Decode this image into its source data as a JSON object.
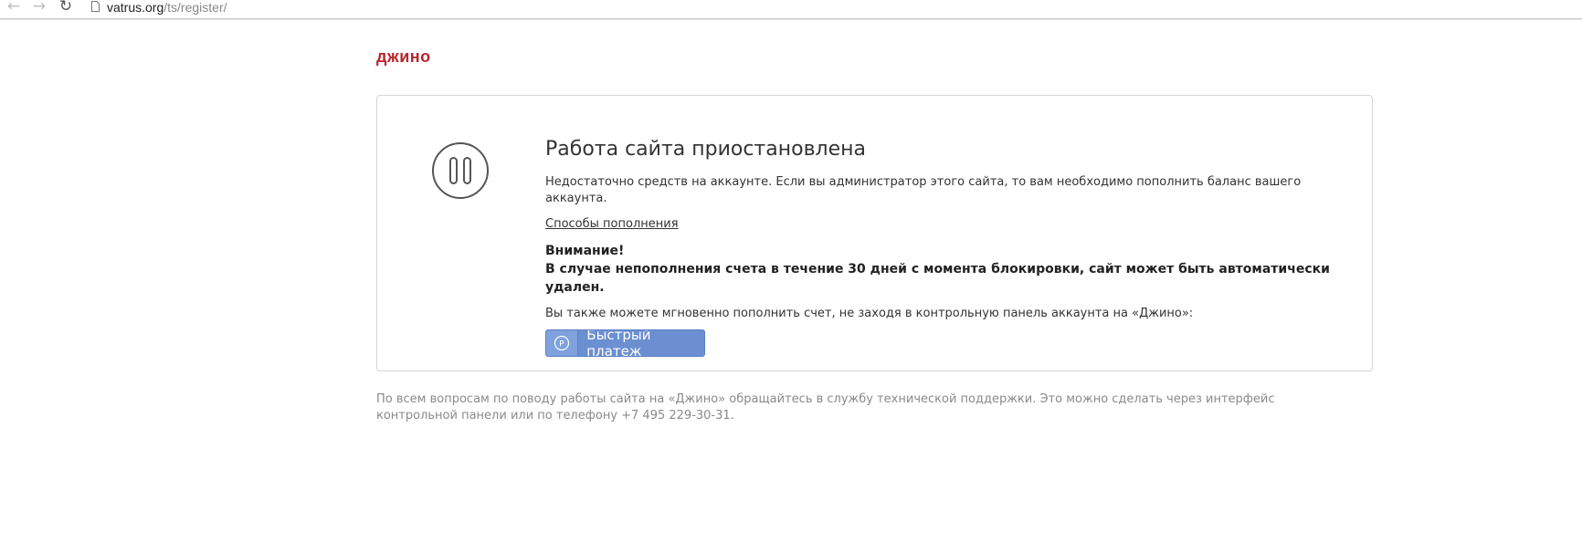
{
  "browser": {
    "url_host": "vatrus.org",
    "url_path": "/ts/register/",
    "back_icon": "arrow-left-icon",
    "forward_icon": "arrow-right-icon",
    "reload_icon": "reload-icon"
  },
  "logo": {
    "text": "джино",
    "color": "#b8252d"
  },
  "card": {
    "icon": "pause-circle-icon",
    "title": "Работа сайта приостановлена",
    "text": "Недостаточно средств на аккаунте. Если вы администратор этого сайта, то вам необходимо пополнить баланс вашего аккаунта.",
    "link": "Способы пополнения",
    "warning_title": "Внимание!",
    "warning_text": "В случае непополнения счета в течение 30 дней с момента блокировки, сайт может быть автоматически удален.",
    "also_text": "Вы также можете мгновенно пополнить счет, не заходя в контрольную панель аккаунта на «Джино»:",
    "pay_button": {
      "icon": "ruble-circle-icon",
      "icon_glyph": "Р",
      "label": "Быстрый платеж",
      "color": "#6b8fd1"
    }
  },
  "footer": {
    "text": "По всем вопросам по поводу работы сайта на «Джино» обращайтесь в службу технической поддержки. Это можно сделать через интерфейс контрольной панели или по телефону +7 495 229-30-31."
  }
}
